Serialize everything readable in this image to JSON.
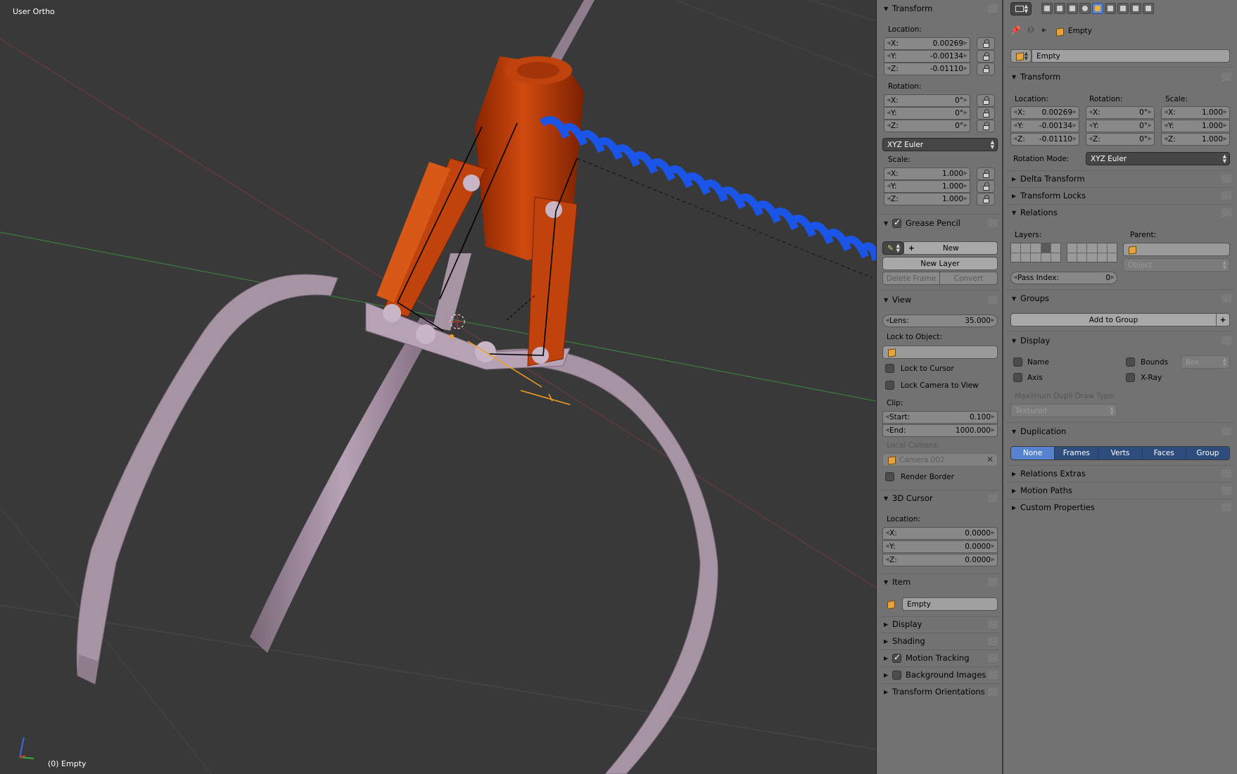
{
  "viewport": {
    "title": "User Ortho",
    "status": "(0) Empty"
  },
  "npanel": {
    "transform": {
      "header": "Transform",
      "location_label": "Location:",
      "location": [
        {
          "k": "X:",
          "v": "0.00269"
        },
        {
          "k": "Y:",
          "v": "-0.00134"
        },
        {
          "k": "Z:",
          "v": "-0.01110"
        }
      ],
      "rotation_label": "Rotation:",
      "rotation": [
        {
          "k": "X:",
          "v": "0°"
        },
        {
          "k": "Y:",
          "v": "0°"
        },
        {
          "k": "Z:",
          "v": "0°"
        }
      ],
      "rotation_mode": "XYZ Euler",
      "scale_label": "Scale:",
      "scale": [
        {
          "k": "X:",
          "v": "1.000"
        },
        {
          "k": "Y:",
          "v": "1.000"
        },
        {
          "k": "Z:",
          "v": "1.000"
        }
      ]
    },
    "grease_pencil": {
      "header": "Grease Pencil",
      "new": "New",
      "new_layer": "New Layer",
      "delete_frame": "Delete Frame",
      "convert": "Convert"
    },
    "view": {
      "header": "View",
      "lens_k": "Lens:",
      "lens_v": "35.000",
      "lock_to_object": "Lock to Object:",
      "lock_to_cursor": "Lock to Cursor",
      "lock_camera": "Lock Camera to View",
      "clip": "Clip:",
      "clip_start_k": "Start:",
      "clip_start_v": "0.100",
      "clip_end_k": "End:",
      "clip_end_v": "1000.000",
      "local_camera": "Local Camera:",
      "camera_name": "Camera.002",
      "render_border": "Render Border"
    },
    "cursor": {
      "header": "3D Cursor",
      "location_label": "Location:",
      "location": [
        {
          "k": "X:",
          "v": "0.0000"
        },
        {
          "k": "Y:",
          "v": "0.0000"
        },
        {
          "k": "Z:",
          "v": "0.0000"
        }
      ]
    },
    "item": {
      "header": "Item",
      "name": "Empty"
    },
    "collapsed": {
      "display": "Display",
      "shading": "Shading",
      "motion_tracking": "Motion Tracking",
      "background_images": "Background Images",
      "transform_orientations": "Transform Orientations"
    }
  },
  "props": {
    "breadcrumb": "Empty",
    "object_name": "Empty",
    "transform": {
      "header": "Transform",
      "location_label": "Location:",
      "rotation_label": "Rotation:",
      "scale_label": "Scale:",
      "location": [
        {
          "k": "X:",
          "v": "0.00269"
        },
        {
          "k": "Y:",
          "v": "-0.00134"
        },
        {
          "k": "Z:",
          "v": "-0.01110"
        }
      ],
      "rotation": [
        {
          "k": "X:",
          "v": "0°"
        },
        {
          "k": "Y:",
          "v": "0°"
        },
        {
          "k": "Z:",
          "v": "0°"
        }
      ],
      "scale": [
        {
          "k": "X:",
          "v": "1.000"
        },
        {
          "k": "Y:",
          "v": "1.000"
        },
        {
          "k": "Z:",
          "v": "1.000"
        }
      ],
      "rotation_mode_label": "Rotation Mode:",
      "rotation_mode": "XYZ Euler"
    },
    "delta_transform": "Delta Transform",
    "transform_locks": "Transform Locks",
    "relations": {
      "header": "Relations",
      "layers_label": "Layers:",
      "parent_label": "Parent:",
      "parent_type": "Object",
      "pass_index_k": "Pass Index:",
      "pass_index_v": "0"
    },
    "groups": {
      "header": "Groups",
      "add": "Add to Group"
    },
    "display": {
      "header": "Display",
      "name": "Name",
      "bounds": "Bounds",
      "bounds_type": "Box",
      "axis": "Axis",
      "xray": "X-Ray",
      "max_dupli_label": "Maximum Dupli Draw Type:",
      "max_dupli": "Textured"
    },
    "duplication": {
      "header": "Duplication",
      "options": [
        "None",
        "Frames",
        "Verts",
        "Faces",
        "Group"
      ],
      "active": "None"
    },
    "relations_extras": "Relations Extras",
    "motion_paths": "Motion Paths",
    "custom_properties": "Custom Properties"
  }
}
